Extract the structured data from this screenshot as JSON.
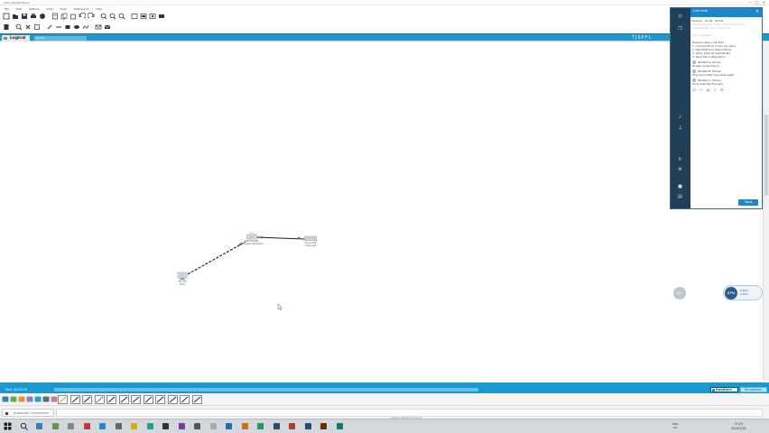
{
  "window": {
    "title": "Cisco Packet Tracer",
    "controls": [
      "—",
      "□",
      "×"
    ]
  },
  "menu": [
    "File",
    "Edit",
    "Options",
    "View",
    "Tools",
    "Extensions",
    "Help"
  ],
  "toolbar": {
    "row1_icons": [
      "new-icon",
      "open-icon",
      "save-icon",
      "print-icon",
      "wizard-icon",
      "network-info-icon",
      "copy-icon",
      "paste-icon",
      "undo-icon",
      "redo-icon",
      "zoom-in-icon",
      "zoom-reset-icon",
      "zoom-out-icon",
      "palette-icon",
      "custom-device-icon",
      "cluster-icon",
      "pdu-icon"
    ],
    "row2_icons": [
      "select-icon",
      "inspect-icon",
      "delete-icon",
      "resize-icon",
      "note-icon",
      "draw-line-icon",
      "rectangle-icon",
      "ellipse-icon",
      "freeform-icon",
      "add-simple-pdu-icon",
      "add-complex-pdu-icon"
    ]
  },
  "workspace": {
    "tab_label": "Logical",
    "root_path": "[Root]",
    "right_label": "TJSPFL"
  },
  "topology": {
    "devices": [
      {
        "id": "pc0",
        "model": "PC-PT",
        "name": "PC0",
        "type": "pc"
      },
      {
        "id": "wrt0",
        "model": "WRT300N",
        "name": "Wireless Router0",
        "type": "router"
      },
      {
        "id": "net0",
        "model": "Cloud-PT",
        "name": "Internet",
        "type": "cloud"
      }
    ],
    "links": [
      {
        "from": "pc0",
        "to": "wrt0",
        "style": "dashed"
      },
      {
        "from": "wrt0",
        "to": "net0",
        "style": "solid"
      }
    ]
  },
  "chat": {
    "header": "Live chat",
    "close": "×",
    "lines": [
      "Teacher · 01:08 · Online",
      "Announcement: today covers WRT300N",
      "configuration and cloud links.",
      "",
      "Host: assistant",
      "",
      "Network setup checklist",
      "1. Connect PC to router via cable",
      "2. Set DHCP and WAN options",
      "3. Verify Internet reachability",
      "4. Save the configuration",
      "Student A: Online",
      "Router shows Online",
      "Student B: Online",
      "Ping works after the cable swap.",
      "Student C: Online",
      "Done with the first part."
    ],
    "actions": [
      "☺",
      "✂",
      "▤",
      "♫",
      "⚙"
    ],
    "rail": [
      "◎",
      "❒",
      "♪",
      "♫",
      "↻",
      "⚙",
      "■",
      "▤"
    ],
    "send": "Send"
  },
  "widgets": {
    "bubble": "NEW",
    "speed_percent": "17%",
    "speed_up": "0.1K/s",
    "speed_down": "0.3K/s"
  },
  "bottom": {
    "time_label": "Time: 00:03:23",
    "realtime": "Realtime",
    "simulation": "Simulation",
    "connection_types": [
      "automatic",
      "console",
      "straight-through",
      "cross-over",
      "fiber",
      "phone",
      "coaxial",
      "serial-dce",
      "serial-dte",
      "octal",
      "iot",
      "usb"
    ],
    "device_label": "Automatic Connection",
    "caption": "Copper Straight-Through"
  },
  "taskbar": {
    "tray": "ENG",
    "tray_sub": "US",
    "clock_time": "21:24",
    "clock_date": "2019/1/18"
  }
}
